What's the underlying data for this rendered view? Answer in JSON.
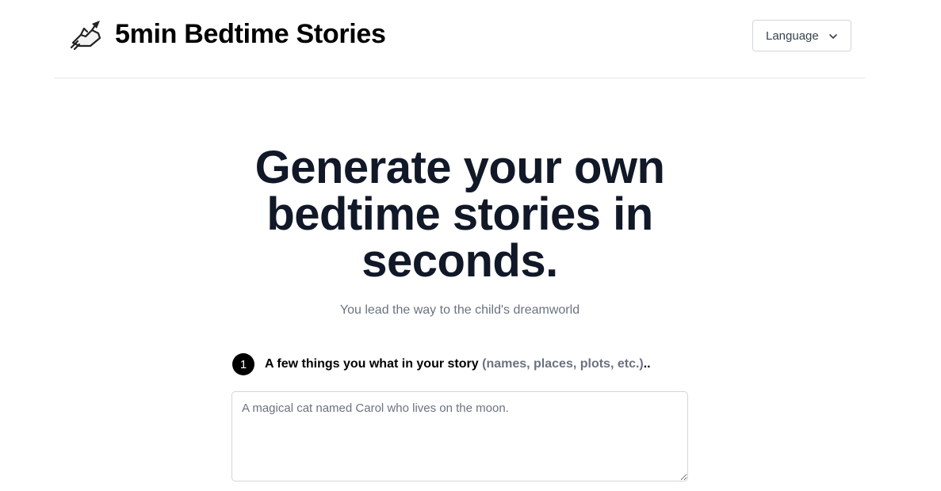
{
  "header": {
    "logo_icon": "writing-hand-icon",
    "title": "5min Bedtime Stories",
    "language_button_label": "Language",
    "language_chevron_icon": "chevron-down-icon"
  },
  "hero": {
    "title": "Generate your own bedtime stories in seconds.",
    "subtitle": "You lead the way to the child's dreamworld"
  },
  "step1": {
    "number": "1",
    "label": "A few things you what in your story",
    "hint": "(names, places, plots, etc.)",
    "suffix": "..",
    "input_placeholder": "A magical cat named Carol who lives on the moon.",
    "input_value": ""
  },
  "colors": {
    "title_text": "#111827",
    "muted_text": "#6b7280",
    "border": "#d1d5db",
    "step_badge": "#000000"
  }
}
